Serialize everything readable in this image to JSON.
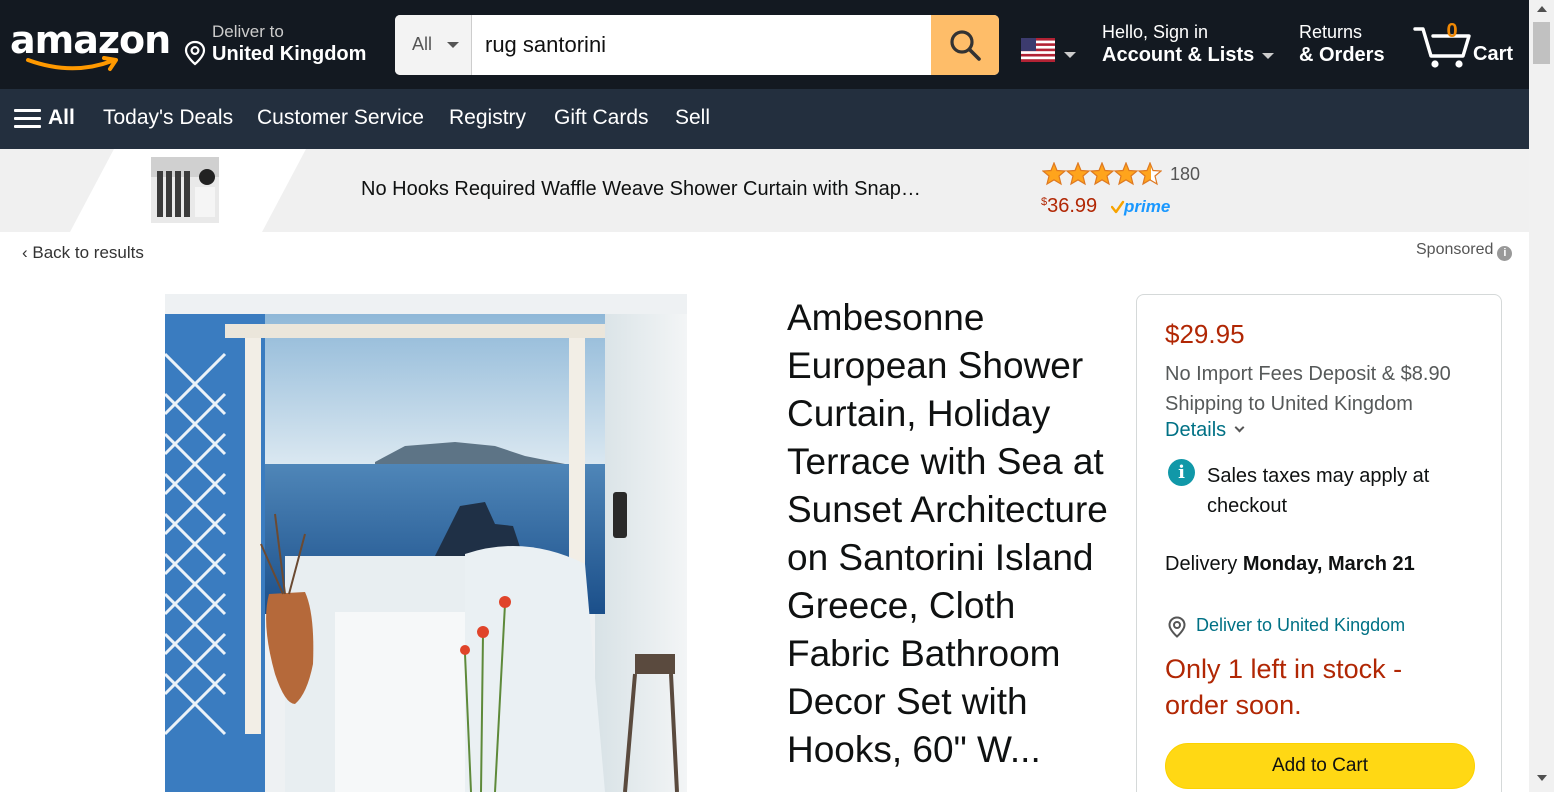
{
  "header": {
    "logo": "amazon",
    "deliver_to_label": "Deliver to",
    "deliver_to_location": "United Kingdom",
    "search": {
      "category": "All",
      "query": "rug santorini"
    },
    "account_greeting": "Hello, Sign in",
    "account_label": "Account & Lists",
    "returns_label": "Returns",
    "orders_label": "& Orders",
    "cart_count": "0",
    "cart_label": "Cart",
    "icons": [
      "location-pin-icon",
      "search-icon",
      "us-flag-icon",
      "cart-icon"
    ]
  },
  "subnav": {
    "all_label": "All",
    "links": [
      "Today's Deals",
      "Customer Service",
      "Registry",
      "Gift Cards",
      "Sell"
    ]
  },
  "sponsored_strip": {
    "title": "No Hooks Required Waffle Weave Shower Curtain with Snap…",
    "rating_stars": 4.5,
    "rating_count": "180",
    "price_symbol": "$",
    "price": "36.99",
    "prime": "prime"
  },
  "breadcrumb": {
    "back_label": "Back to results",
    "sponsored_label": "Sponsored"
  },
  "product": {
    "title": "Ambesonne European Shower Curtain, Holiday Terrace with Sea at Sunset Architecture on Santorini Island Greece, Cloth Fabric Bathroom Decor Set with Hooks, 60\" W..."
  },
  "buybox": {
    "price": "$29.95",
    "shipping": "No Import Fees Deposit & $8.90 Shipping to United Kingdom",
    "details_label": "Details",
    "tax_note": "Sales taxes may apply at checkout",
    "delivery_prefix": "Delivery",
    "delivery_date": "Monday, March 21",
    "deliver_to": "Deliver to United Kingdom",
    "stock": "Only 1 left in stock - order soon.",
    "add_to_cart": "Add to Cart"
  },
  "colors": {
    "nav_bg": "#131921",
    "subnav_bg": "#232f3e",
    "search_button": "#febd69",
    "price_red": "#b12704",
    "link_teal": "#007185",
    "cart_yellow": "#ffd814",
    "star_orange": "#ffa41c"
  }
}
